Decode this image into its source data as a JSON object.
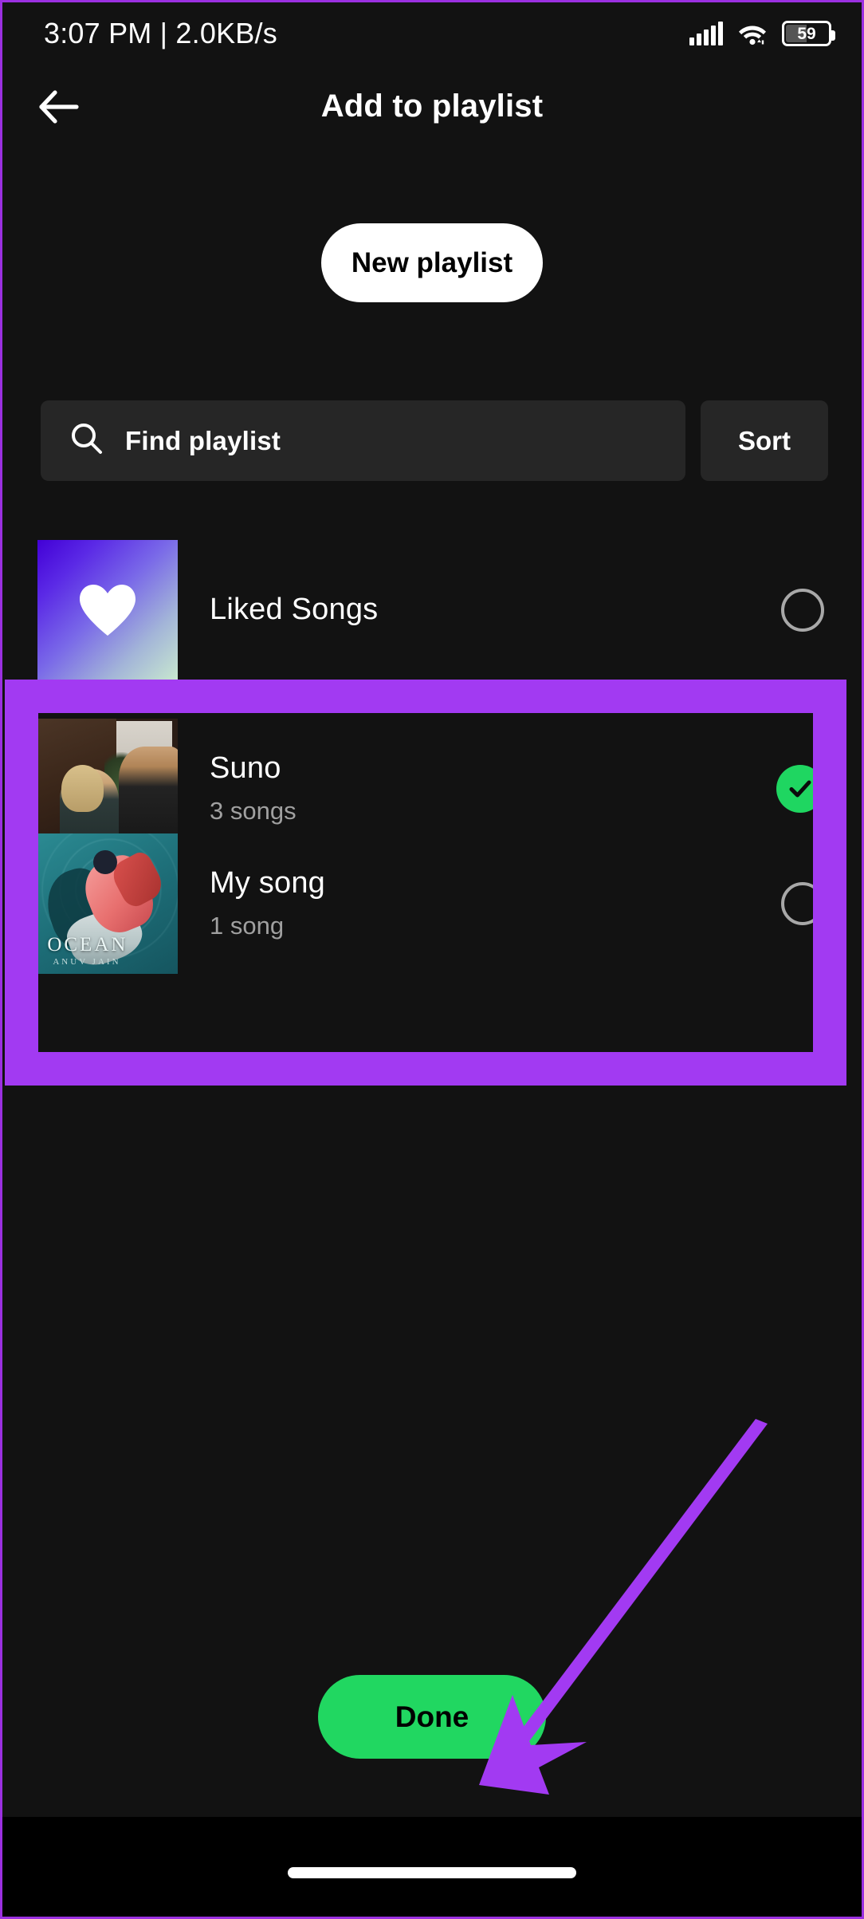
{
  "status_bar": {
    "time_and_speed": "3:07 PM | 2.0KB/s",
    "signal_icon": "signal-bars-icon",
    "wifi_icon": "wifi-icon",
    "battery_level": "59",
    "battery_icon": "battery-icon"
  },
  "header": {
    "back_icon": "back-arrow-icon",
    "title": "Add to playlist"
  },
  "actions": {
    "new_playlist_label": "New playlist",
    "done_label": "Done"
  },
  "search": {
    "icon": "search-icon",
    "placeholder": "Find playlist",
    "value": "",
    "sort_label": "Sort"
  },
  "playlists": [
    {
      "title": "Liked Songs",
      "subtitle": "",
      "artwork": "liked-songs-gradient-heart",
      "selected": false,
      "toggle_icon": "unchecked-circle-icon"
    },
    {
      "title": "Suno",
      "subtitle": "3 songs",
      "artwork": "suno-album-art",
      "selected": true,
      "toggle_icon": "green-check-circle-icon"
    },
    {
      "title": "My song",
      "subtitle": "1 song",
      "artwork": "ocean-album-art",
      "artwork_title": "OCEAN",
      "artwork_artist": "ANUV JAIN",
      "selected": false,
      "toggle_icon": "unchecked-circle-icon"
    }
  ],
  "annotations": {
    "highlight_box_color": "#a23af2",
    "arrow_color": "#a23af2",
    "arrow_target": "done-button"
  },
  "colors": {
    "background": "#121212",
    "surface": "#262626",
    "accent_green": "#21d761",
    "accent_purple": "#a23af2",
    "text_primary": "#ffffff",
    "text_secondary": "#a0a0a0"
  },
  "system_nav": {
    "home_indicator": "home-indicator"
  }
}
